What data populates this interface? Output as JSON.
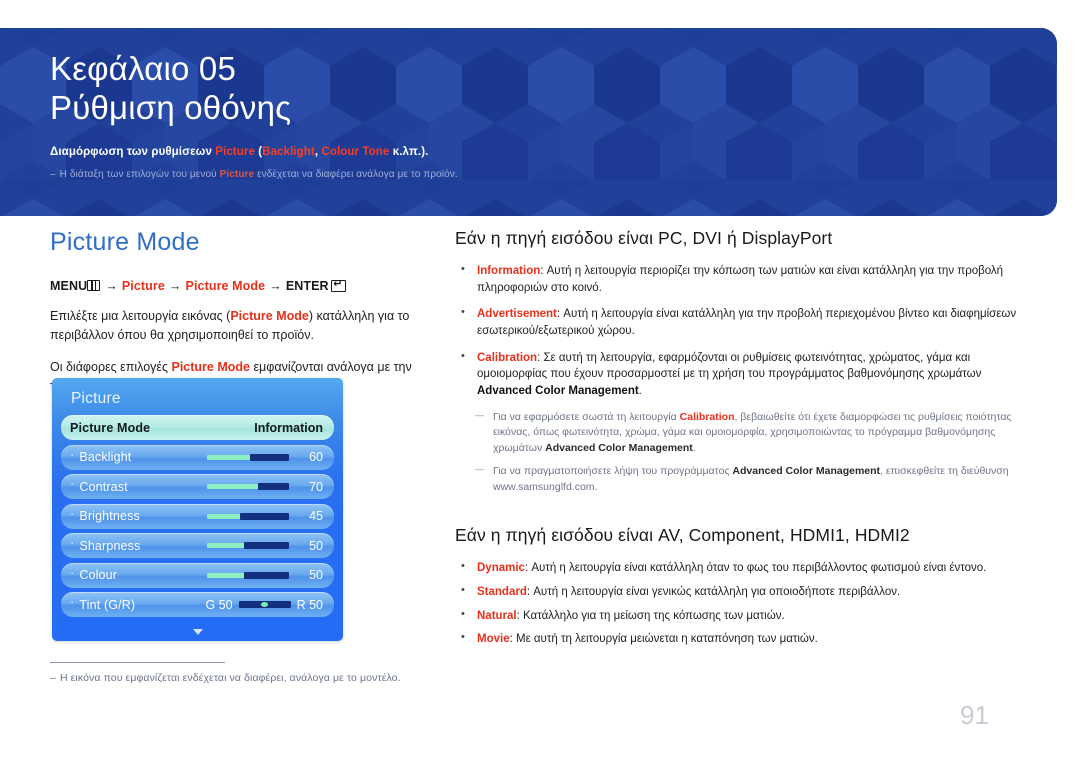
{
  "banner": {
    "chapter_label": "Κεφάλαιο 05",
    "chapter_title": "Ρύθμιση οθόνης",
    "subtitle_pre": "Διαμόρφωση των ρυθμίσεων ",
    "subtitle_hl1": "Picture",
    "subtitle_mid1": " (",
    "subtitle_hl2": "Backlight",
    "subtitle_mid2": ", ",
    "subtitle_hl3": "Colour Tone",
    "subtitle_post": " κ.λπ.).",
    "note_dash": "–",
    "note_pre": "Η διάταξη των επιλογών του μενού ",
    "note_hl": "Picture",
    "note_post": " ενδέχεται να διαφέρει ανάλογα με το προϊόν.",
    "bg_color": "#20409a"
  },
  "left": {
    "section_title": "Picture Mode",
    "menu_path": {
      "menu_label": "MENU",
      "arrow": "→",
      "step1": "Picture",
      "step2": "Picture Mode",
      "enter_label": "ENTER"
    },
    "paragraph1_pre": "Επιλέξτε μια λειτουργία εικόνας (",
    "paragraph1_hl": "Picture Mode",
    "paragraph1_post": ") κατάλληλη για το περιβάλλον όπου θα χρησιμοποιηθεί το προϊόν.",
    "paragraph2_pre": "Οι διάφορες επιλογές ",
    "paragraph2_hl": "Picture Mode",
    "paragraph2_post": " εμφανίζονται ανάλογα με την τρέχουσα πηγή εισόδου.",
    "footnote_dash": "–",
    "footnote": "Η εικόνα που εμφανίζεται ενδέχεται να διαφέρει, ανάλογα με το μοντέλο."
  },
  "osd": {
    "title": "Picture",
    "rows": [
      {
        "label": "Picture Mode",
        "value_text": "Information",
        "selected": true,
        "type": "value"
      },
      {
        "label": "Backlight",
        "value": 60,
        "type": "slider",
        "fill_pct": 52
      },
      {
        "label": "Contrast",
        "value": 70,
        "type": "slider",
        "fill_pct": 62
      },
      {
        "label": "Brightness",
        "value": 45,
        "type": "slider",
        "fill_pct": 40
      },
      {
        "label": "Sharpness",
        "value": 50,
        "type": "slider",
        "fill_pct": 45
      },
      {
        "label": "Colour",
        "value": 50,
        "type": "slider",
        "fill_pct": 45
      },
      {
        "label": "Tint (G/R)",
        "type": "tint",
        "g_label": "G 50",
        "r_label": "R 50"
      }
    ],
    "scroll_down_icon": "chevron-down-icon",
    "colors": {
      "panel_top": "#55a8f0",
      "panel_bottom": "#246cf6",
      "selected_row": "#b6ebe6",
      "slider_fill": "#8ef0c2",
      "slider_rest": "#12307e"
    }
  },
  "right": {
    "heading1": "Εάν η πηγή εισόδου είναι PC, DVI ή DisplayPort",
    "bullets1": [
      {
        "term": "Information",
        "text": ": Αυτή η λειτουργία περιορίζει την κόπωση των ματιών και είναι κατάλληλη για την προβολή πληροφοριών στο κοινό."
      },
      {
        "term": "Advertisement",
        "text": ": Αυτή η λειτουργία είναι κατάλληλη για την προβολή περιεχομένου βίντεο και διαφημίσεων εσωτερικού/εξωτερικού χώρου."
      },
      {
        "term": "Calibration",
        "text": ": Σε αυτή τη λειτουργία, εφαρμόζονται οι ρυθμίσεις φωτεινότητας, χρώματος, γάμα και ομοιομορφίας που έχουν προσαρμοστεί με τη χρήση του προγράμματος βαθμονόμησης χρωμάτων ",
        "bold_tail": "Advanced Color Management",
        "tail_end": "."
      }
    ],
    "notes1": [
      {
        "pre": "Για να εφαρμόσετε σωστά τη λειτουργία ",
        "red": "Calibration",
        "mid": ", βεβαιωθείτε ότι έχετε διαμορφώσει τις ρυθμίσεις ποιότητας εικόνας, όπως φωτεινότητα, χρώμα, γάμα και ομοιομορφία, χρησιμοποιώντας το πρόγραμμα βαθμονόμησης χρωμάτων ",
        "bold": "Advanced Color Management",
        "post": "."
      },
      {
        "pre": "Για να πραγματοποιήσετε λήψη του προγράμματος ",
        "bold": "Advanced Color Management",
        "post": ", επισκεφθείτε τη διεύθυνση www.samsunglfd.com."
      }
    ],
    "heading2": "Εάν η πηγή εισόδου είναι AV, Component, HDMI1, HDMI2",
    "bullets2": [
      {
        "term": "Dynamic",
        "text": ": Αυτή η λειτουργία είναι κατάλληλη όταν το φως του περιβάλλοντος φωτισμού είναι έντονο."
      },
      {
        "term": "Standard",
        "text": ": Αυτή η λειτουργία είναι γενικώς κατάλληλη για οποιοδήποτε περιβάλλον."
      },
      {
        "term": "Natural",
        "text": ": Κατάλληλο για τη μείωση της κόπωσης των ματιών."
      },
      {
        "term": "Movie",
        "text": ": Με αυτή τη λειτουργία μειώνεται η καταπόνηση των ματιών."
      }
    ]
  },
  "page_number": "91"
}
